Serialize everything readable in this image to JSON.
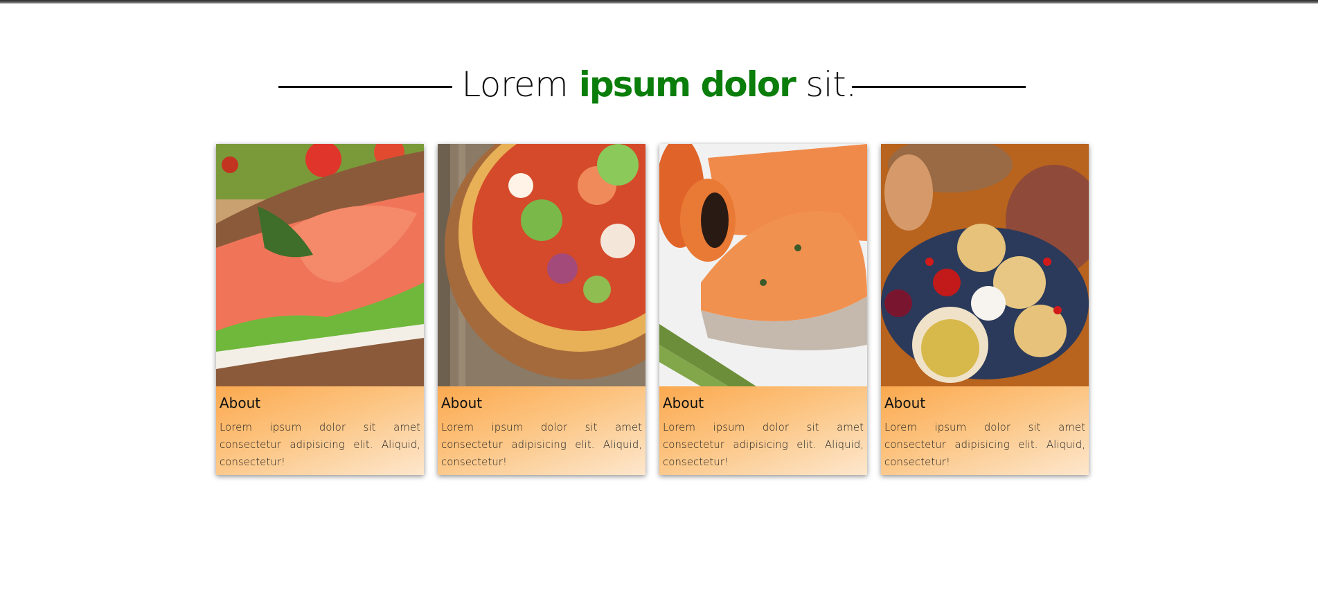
{
  "heading": {
    "prefix": "Lorem ",
    "accent": "ipsum dolor",
    "suffix": " sit."
  },
  "cards": [
    {
      "title": "About",
      "text": "Lorem ipsum dolor sit amet consectetur adipisicing elit. Aliquid, consectetur!",
      "image": "salmon-sandwich-image"
    },
    {
      "title": "About",
      "text": "Lorem ipsum dolor sit amet consectetur adipisicing elit. Aliquid, consectetur!",
      "image": "pizza-image"
    },
    {
      "title": "About",
      "text": "Lorem ipsum dolor sit amet consectetur adipisicing elit. Aliquid, consectetur!",
      "image": "grilled-salmon-image"
    },
    {
      "title": "About",
      "text": "Lorem ipsum dolor sit amet consectetur adipisicing elit. Aliquid, consectetur!",
      "image": "feast-platter-image"
    }
  ],
  "colors": {
    "accent": "#0a7d0a",
    "card_gradient_start": "#fba94f",
    "card_gradient_end": "#fde7cd"
  }
}
